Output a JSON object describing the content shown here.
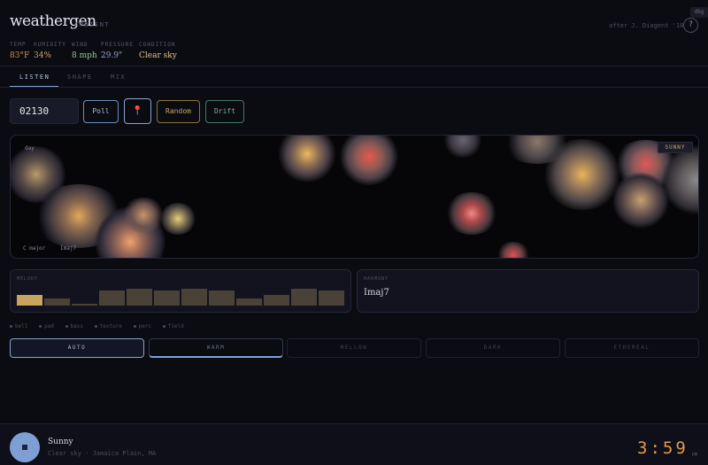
{
  "app": {
    "name": "weathergen",
    "mode_tag": "AMBIENT",
    "credit": "after J. Diagent '18",
    "help": "?",
    "debug": "dbg"
  },
  "stats": [
    {
      "label": "TEMP",
      "value": "83°F",
      "color": "#d9924a"
    },
    {
      "label": "HUMIDITY",
      "value": "34%",
      "color": "#c9a66a"
    },
    {
      "label": "WIND",
      "value": "8 mph",
      "color": "#8fcf8f"
    },
    {
      "label": "PRESSURE",
      "value": "29.9\"",
      "color": "#9aa6c8"
    },
    {
      "label": "CONDITION",
      "value": "Clear sky",
      "color": "#e0c48a"
    }
  ],
  "tabs": [
    {
      "label": "LISTEN",
      "active": true
    },
    {
      "label": "SHAPE",
      "active": false
    },
    {
      "label": "MIX",
      "active": false
    }
  ],
  "controls": {
    "zip_value": "02130",
    "poll_label": "Poll",
    "pin_icon": "location-pin-icon",
    "random_label": "Random",
    "drift_label": "Drift"
  },
  "visualizer": {
    "time_label": "day",
    "condition_badge": "SUNNY",
    "key_label": "C major",
    "chord_label": "Imaj7"
  },
  "melody": {
    "label": "MELODY",
    "levels": [
      0.55,
      0.35,
      0.08,
      0.75,
      0.85,
      0.75,
      0.85,
      0.75,
      0.35,
      0.55,
      0.85,
      0.75
    ],
    "active_step": 0
  },
  "harmony": {
    "label": "HARMONY",
    "value": "Imaj7"
  },
  "layers": [
    "bell",
    "pad",
    "bass",
    "texture",
    "perc",
    "field"
  ],
  "modes": [
    {
      "label": "AUTO",
      "state": "active"
    },
    {
      "label": "WARM",
      "state": "selected"
    },
    {
      "label": "MELLOW",
      "state": "off"
    },
    {
      "label": "DARK",
      "state": "off"
    },
    {
      "label": "ETHEREAL",
      "state": "off"
    }
  ],
  "now_playing": {
    "title": "Sunny",
    "subtitle": "Clear sky · Jamaica Plain, MA",
    "time": "3:59",
    "ampm": "PM"
  }
}
